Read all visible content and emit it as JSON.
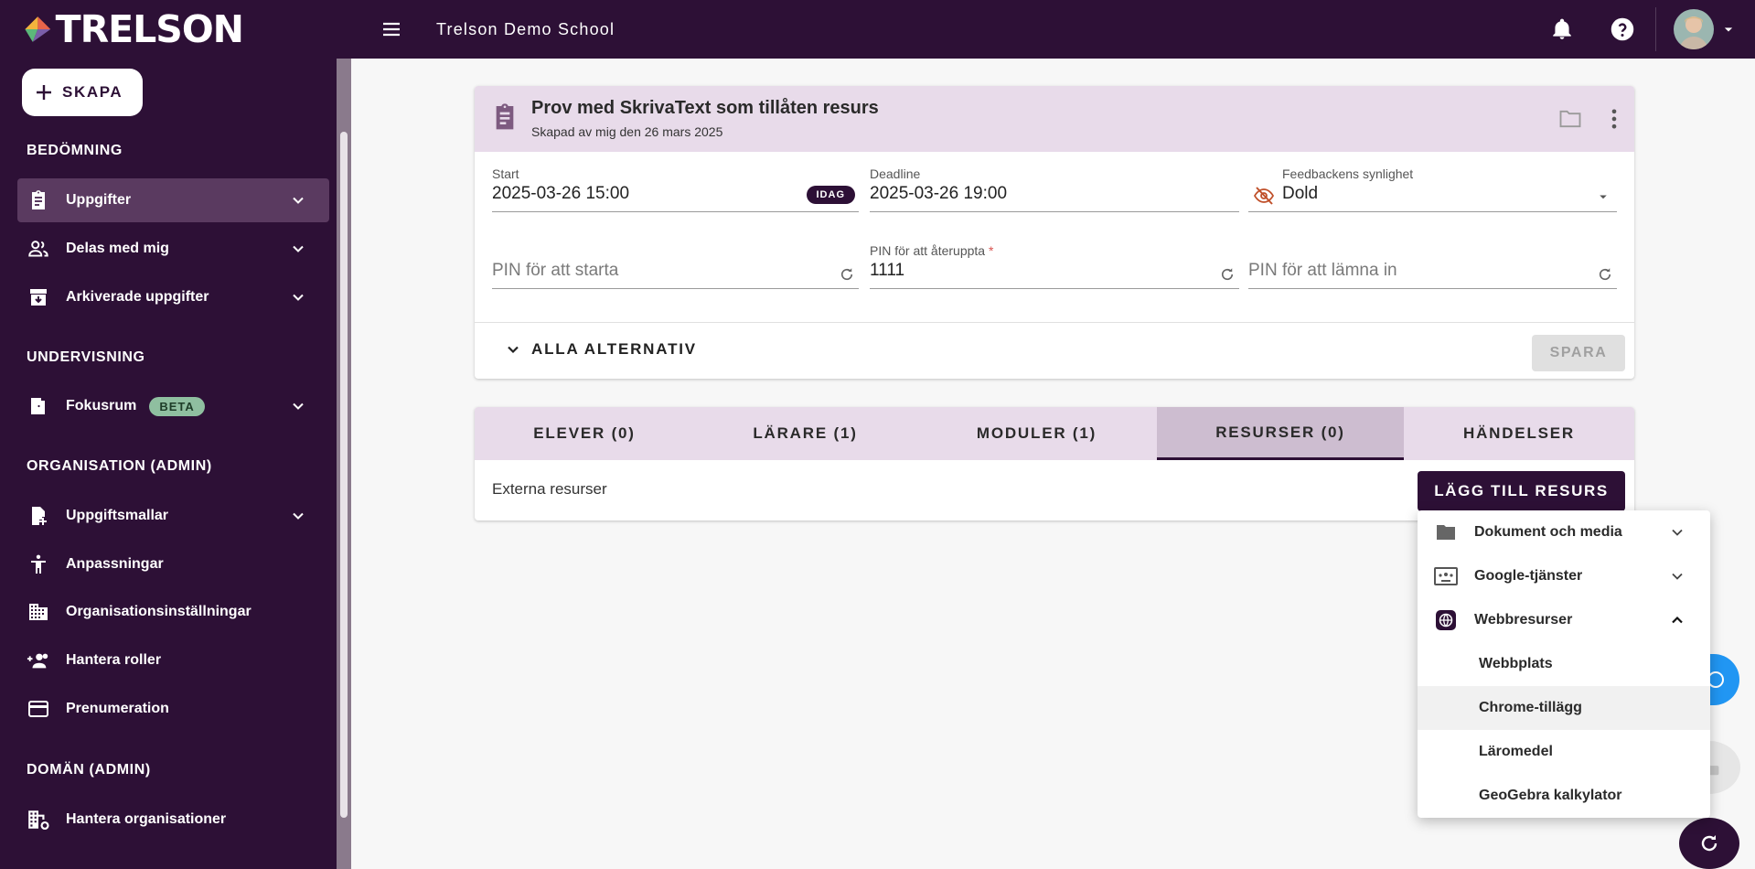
{
  "brand": {
    "name": "TRELSON"
  },
  "header": {
    "school": "Trelson Demo School"
  },
  "sidebar": {
    "create_label": "SKAPA",
    "sections": {
      "assessment": "BEDÖMNING",
      "teaching": "UNDERVISNING",
      "org": "ORGANISATION (ADMIN)",
      "domain": "DOMÄN (ADMIN)"
    },
    "items": {
      "tasks": "Uppgifter",
      "shared": "Delas med mig",
      "archived": "Arkiverade uppgifter",
      "focus": "Fokusrum",
      "focus_badge": "BETA",
      "templates": "Uppgiftsmallar",
      "adaptations": "Anpassningar",
      "org_settings": "Organisationsinställningar",
      "roles": "Hantera roller",
      "subscription": "Prenumeration",
      "orgs": "Hantera organisationer"
    }
  },
  "assignment": {
    "title": "Prov med SkrivaText som tillåten resurs",
    "subtitle": "Skapad av mig den 26 mars 2025",
    "start_label": "Start",
    "start_value": "2025-03-26 15:00",
    "today_chip": "IDAG",
    "deadline_label": "Deadline",
    "deadline_value": "2025-03-26 19:00",
    "feedback_label": "Feedbackens synlighet",
    "feedback_value": "Dold",
    "pin_start_placeholder": "PIN för att starta",
    "pin_resume_label": "PIN för att återuppta",
    "pin_resume_required": "*",
    "pin_resume_value": "1111",
    "pin_submit_placeholder": "PIN för att lämna in",
    "all_options": "ALLA ALTERNATIV",
    "save": "SPARA"
  },
  "tabs": [
    {
      "label": "ELEVER (0)"
    },
    {
      "label": "LÄRARE (1)"
    },
    {
      "label": "MODULER (1)"
    },
    {
      "label": "RESURSER (0)"
    },
    {
      "label": "HÄNDELSER"
    }
  ],
  "active_tab": "RESURSER (0)",
  "resources": {
    "external_label": "Externa resurser",
    "add_button": "LÄGG TILL RESURS"
  },
  "resource_menu": {
    "groups": [
      {
        "label": "Dokument och media",
        "icon": "folder-icon",
        "expanded": false
      },
      {
        "label": "Google-tjänster",
        "icon": "google-classroom-icon",
        "expanded": false
      },
      {
        "label": "Webbresurser",
        "icon": "globe-icon",
        "expanded": true
      }
    ],
    "web_items": [
      "Webbplats",
      "Chrome-tillägg",
      "Läromedel",
      "GeoGebra kalkylator"
    ],
    "highlighted": "Chrome-tillägg"
  },
  "colors": {
    "brand": "#2d1036",
    "header_tint": "#e8dbea",
    "active_tab": "#cdbdd0",
    "fab_blue": "#2196f3"
  }
}
